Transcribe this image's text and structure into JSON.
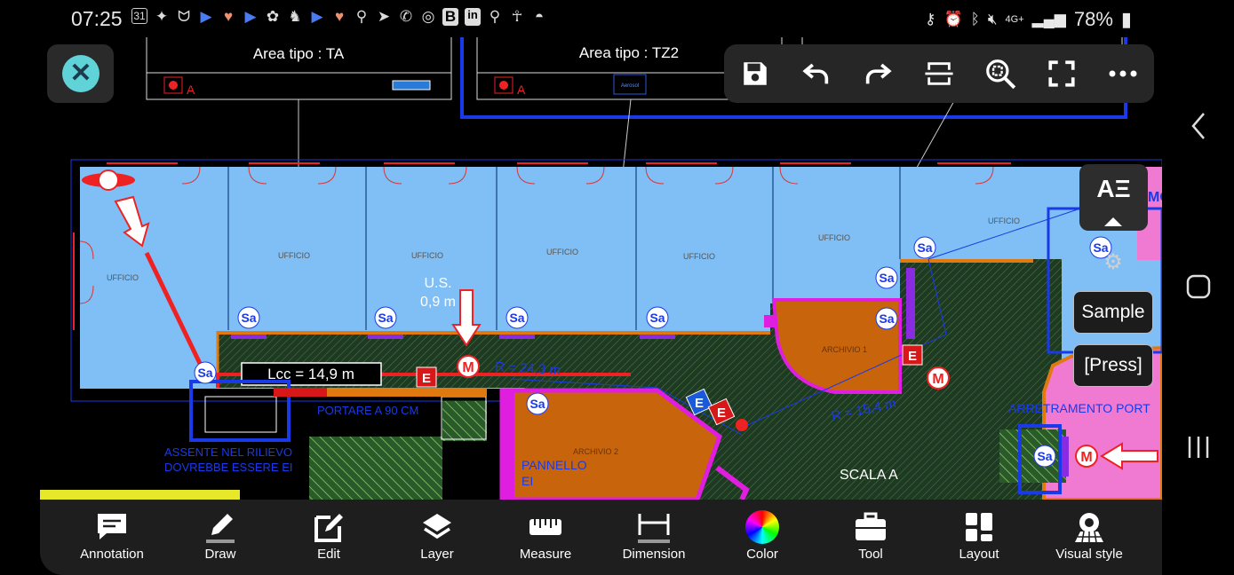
{
  "status_bar": {
    "time": "07:25",
    "date_icon_text": "31",
    "network": "4G+",
    "battery": "78%",
    "left_icons": [
      "calendar-icon",
      "bird-icon",
      "cat-icon",
      "play-icon",
      "heart-icon",
      "play-icon",
      "flower-icon",
      "person-icon",
      "play-icon",
      "heart-icon",
      "location-icon",
      "telegram-icon",
      "phone-icon",
      "run-icon",
      "b-icon",
      "linkedin-icon",
      "location-icon",
      "accessibility-icon",
      "arc-icon"
    ],
    "right_icons": [
      "key-icon",
      "alarm-icon",
      "bluetooth-icon",
      "mute-icon",
      "signal-icon",
      "battery-icon"
    ]
  },
  "drawing": {
    "legend_left": {
      "line1": "Area tipo : TA",
      "marker": "A"
    },
    "legend_mid": {
      "line1": "Area tipo : TZ2",
      "marker": "A",
      "box_text": "Aerosol"
    },
    "rooms": [
      "UFFICIO",
      "UFFICIO",
      "UFFICIO",
      "UFFICIO",
      "UFFICIO",
      "UFFICIO",
      "UFFICIO"
    ],
    "archivio1": "ARCHIVIO 1",
    "archivio2": "ARCHIVIO 2",
    "us_label": "U.S.",
    "us_value": "0,9 m",
    "lcc_label": "Lcc = 14,9 m",
    "r1": "R = 24,3 m",
    "r2": "R = 15,4 m",
    "portare": "PORTARE A 90 CM",
    "assente1": "ASSENTE NEL RILIEVO",
    "assente2": "DOVREBBE ESSERE EI",
    "pannello1": "PANNELLO",
    "pannello2": "EI",
    "scala": "SCALA A",
    "arretramento": "ARRETRAMENTO PORT",
    "sa": "Sa",
    "e": "E",
    "m": "M",
    "mo": "MO"
  },
  "top_toolbar": {
    "icons": [
      "save-icon",
      "undo-icon",
      "redo-icon",
      "section-icon",
      "zoom-extents-icon",
      "fullscreen-icon",
      "more-icon"
    ]
  },
  "side": {
    "text_style_button": "AΞ",
    "sample_label": "Sample",
    "press_label": "[Press]"
  },
  "bottom_toolbar": {
    "items": [
      {
        "label": "Annotation",
        "icon": "annotation-icon"
      },
      {
        "label": "Draw",
        "icon": "pencil-icon"
      },
      {
        "label": "Edit",
        "icon": "edit-icon"
      },
      {
        "label": "Layer",
        "icon": "layers-icon"
      },
      {
        "label": "Measure",
        "icon": "ruler-icon"
      },
      {
        "label": "Dimension",
        "icon": "dimension-icon"
      },
      {
        "label": "Color",
        "icon": "color-wheel-icon"
      },
      {
        "label": "Tool",
        "icon": "toolbox-icon"
      },
      {
        "label": "Layout",
        "icon": "layout-icon"
      },
      {
        "label": "Visual style",
        "icon": "visual-style-icon"
      }
    ]
  },
  "colors": {
    "room_blue": "#7fbff5",
    "hatch_green": "#1f3a22",
    "archive_orange": "#c8640b",
    "magenta": "#e01ee0",
    "pink": "#f07ad2",
    "accent_cyan": "#5fd3d8"
  }
}
